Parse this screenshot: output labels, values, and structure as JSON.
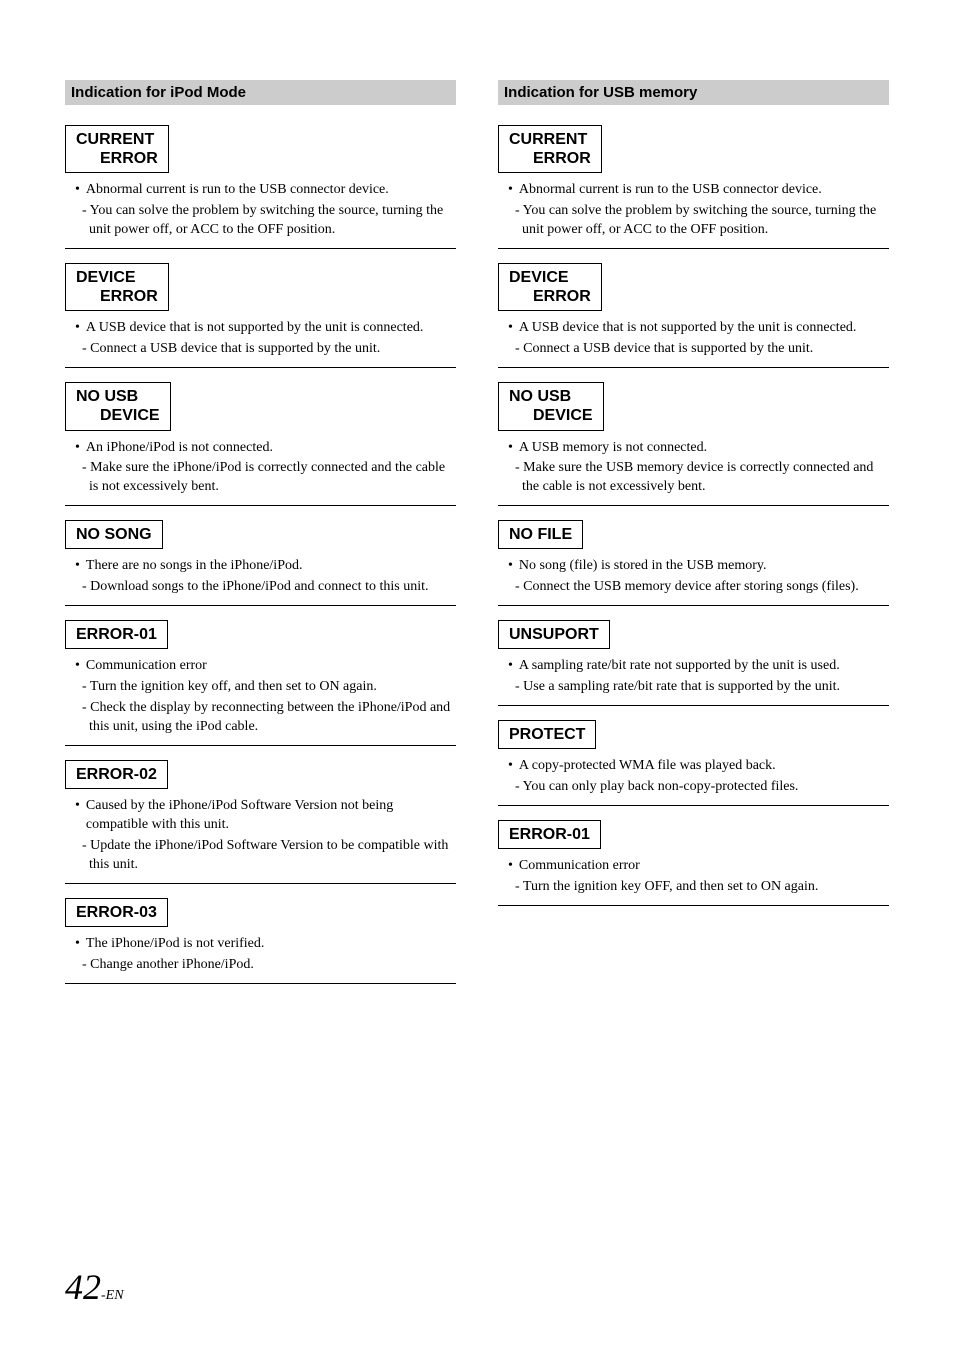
{
  "left": {
    "header": "Indication for iPod Mode",
    "items": [
      {
        "box": [
          "CURRENT",
          "ERROR"
        ],
        "bullet": "Abnormal current is run to the USB connector device.",
        "subs": [
          "- You can solve the problem by switching the source, turning the unit power off, or ACC to the OFF position."
        ]
      },
      {
        "box": [
          "DEVICE",
          "ERROR"
        ],
        "bullet": "A USB device that is not supported by the unit is connected.",
        "subs": [
          "- Connect a USB device that is supported by the unit."
        ]
      },
      {
        "box": [
          "NO USB",
          "DEVICE"
        ],
        "bullet": "An iPhone/iPod is not connected.",
        "subs": [
          "- Make sure the iPhone/iPod is correctly connected and the cable is not excessively bent."
        ]
      },
      {
        "box": [
          "NO SONG"
        ],
        "bullet": "There are no songs in the iPhone/iPod.",
        "subs": [
          "- Download songs to the iPhone/iPod and connect to this unit."
        ]
      },
      {
        "box": [
          "ERROR-01"
        ],
        "bullet": "Communication error",
        "subs": [
          "- Turn the ignition key off, and then set to ON again.",
          "- Check the display by reconnecting between the iPhone/iPod and this unit, using the iPod cable."
        ]
      },
      {
        "box": [
          "ERROR-02"
        ],
        "bullet": "Caused by the iPhone/iPod Software Version not being compatible with this unit.",
        "subs": [
          "- Update the iPhone/iPod Software Version to be compatible with this unit."
        ]
      },
      {
        "box": [
          "ERROR-03"
        ],
        "bullet": "The iPhone/iPod is not verified.",
        "subs": [
          "- Change another iPhone/iPod."
        ]
      }
    ]
  },
  "right": {
    "header": "Indication for USB memory",
    "items": [
      {
        "box": [
          "CURRENT",
          "ERROR"
        ],
        "bullet": "Abnormal current is run to the USB connector device.",
        "subs": [
          "- You can solve the problem by switching the source, turning the unit power off, or ACC to the OFF position."
        ]
      },
      {
        "box": [
          "DEVICE",
          "ERROR"
        ],
        "bullet": "A USB device that is not supported by the unit is connected.",
        "subs": [
          "- Connect a USB device that is supported by the unit."
        ]
      },
      {
        "box": [
          "NO USB",
          "DEVICE"
        ],
        "bullet": "A USB memory is not connected.",
        "subs": [
          "- Make sure the USB memory device is correctly connected and the cable is not excessively bent."
        ]
      },
      {
        "box": [
          "NO FILE"
        ],
        "bullet": "No song (file) is stored in the USB memory.",
        "subs": [
          "- Connect the USB memory device after storing songs (files)."
        ]
      },
      {
        "box": [
          "UNSUPORT"
        ],
        "bullet": "A sampling rate/bit rate not supported by the unit is used.",
        "subs": [
          "- Use a sampling rate/bit rate that is supported by the unit."
        ]
      },
      {
        "box": [
          "PROTECT"
        ],
        "bullet": "A copy-protected WMA file was played back.",
        "subs": [
          "- You can only play back non-copy-protected files."
        ]
      },
      {
        "box": [
          "ERROR-01"
        ],
        "bullet": "Communication error",
        "subs": [
          "- Turn the ignition key OFF, and then set to ON again."
        ]
      }
    ]
  },
  "page": {
    "num": "42",
    "dash": "-",
    "suffix": "EN"
  }
}
